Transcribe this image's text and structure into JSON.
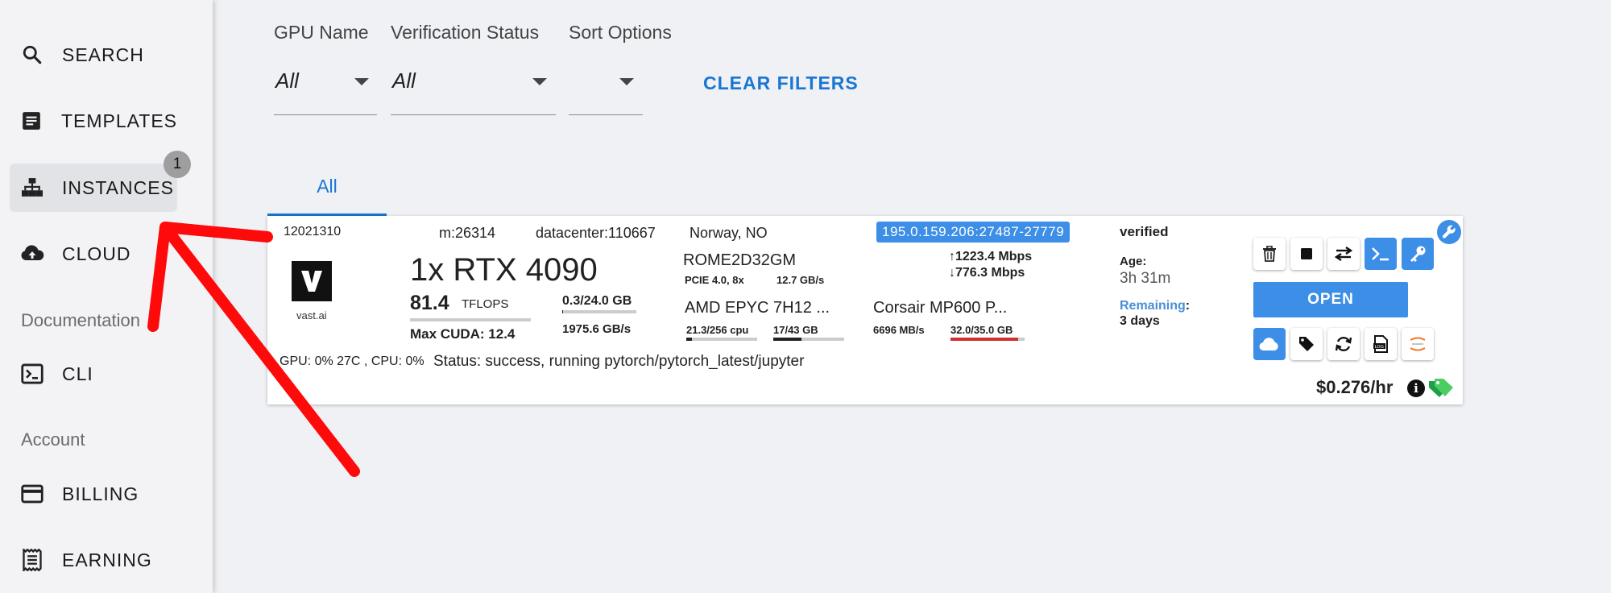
{
  "sidebar": {
    "items": [
      {
        "label": "SEARCH",
        "icon": "search-icon"
      },
      {
        "label": "TEMPLATES",
        "icon": "document-icon"
      },
      {
        "label": "INSTANCES",
        "icon": "hierarchy-icon",
        "badge": "1"
      },
      {
        "label": "CLOUD",
        "icon": "cloud-upload-icon"
      }
    ],
    "documentation_label": "Documentation",
    "doc_items": [
      {
        "label": "CLI",
        "icon": "terminal-icon"
      }
    ],
    "account_label": "Account",
    "account_items": [
      {
        "label": "BILLING",
        "icon": "credit-card-icon"
      },
      {
        "label": "EARNING",
        "icon": "receipt-icon"
      }
    ]
  },
  "filters": {
    "gpu_name": {
      "label": "GPU Name",
      "value": "All"
    },
    "verification_status": {
      "label": "Verification Status",
      "value": "All"
    },
    "sort_options": {
      "label": "Sort Options",
      "value": ""
    },
    "clear_label": "CLEAR FILTERS"
  },
  "tabs": [
    {
      "label": "All"
    }
  ],
  "instance": {
    "id": "12021310",
    "machine": "m:26314",
    "datacenter": "datacenter:110667",
    "location": "Norway, NO",
    "ip": "195.0.159.206:27487-27779",
    "verified": "verified",
    "logo_text": "vast.ai",
    "gpu": "1x RTX 4090",
    "tflops_value": "81.4",
    "tflops_unit": "TFLOPS",
    "max_cuda": "Max CUDA: 12.4",
    "vram": "0.3/24.0 GB",
    "vram_fraction": 0.0125,
    "bandwidth": "1975.6 GB/s",
    "motherboard": "ROME2D32GM",
    "pcie": "PCIE 4.0, 8x",
    "pcie_speed": "12.7 GB/s",
    "cpu": "AMD EPYC 7H12 ...",
    "cpu_usage": "21.3/256 cpu",
    "cpu_fraction": 0.083,
    "ram": "17/43 GB",
    "ram_fraction": 0.395,
    "upload": "1223.4 Mbps",
    "download": "776.3 Mbps",
    "disk": "Corsair MP600 P...",
    "disk_speed": "6696 MB/s",
    "disk_usage": "32.0/35.0 GB",
    "disk_fraction": 0.914,
    "age_label": "Age:",
    "age_value": "3h 31m",
    "remaining_label": "Remaining",
    "remaining_colon": ":",
    "remaining_value": "3 days",
    "open_label": "OPEN",
    "gpu_stats": "GPU: 0% 27C , CPU: 0%",
    "status": "Status: success, running pytorch/pytorch_latest/jupyter",
    "price": "$0.276/hr",
    "colors": {
      "accent": "#3d8ee6",
      "link": "#1976d2",
      "disk_bar": "#d32f2f",
      "tag": "#3cb371",
      "annotation_arrow": "#ff0a0a"
    }
  }
}
